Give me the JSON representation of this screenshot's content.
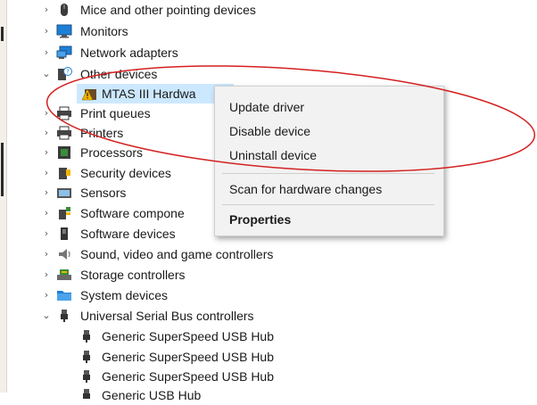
{
  "tree": {
    "items": [
      {
        "label": "Mice and other pointing devices",
        "expanded": false,
        "icon": "mouse-icon"
      },
      {
        "label": "Monitors",
        "expanded": false,
        "icon": "monitor-icon"
      },
      {
        "label": "Network adapters",
        "expanded": false,
        "icon": "network-adapter-icon"
      },
      {
        "label": "Other devices",
        "expanded": true,
        "icon": "other-devices-icon"
      },
      {
        "label": "MTAS III Hardwa",
        "child": true,
        "selected": true,
        "icon": "warning-device-icon"
      },
      {
        "label": "Print queues",
        "expanded": false,
        "icon": "print-queue-icon"
      },
      {
        "label": "Printers",
        "expanded": false,
        "icon": "printer-icon"
      },
      {
        "label": "Processors",
        "expanded": false,
        "icon": "processor-icon"
      },
      {
        "label": "Security devices",
        "expanded": false,
        "icon": "security-device-icon"
      },
      {
        "label": "Sensors",
        "expanded": false,
        "icon": "sensor-icon"
      },
      {
        "label": "Software compone",
        "expanded": false,
        "icon": "software-component-icon"
      },
      {
        "label": "Software devices",
        "expanded": false,
        "icon": "software-device-icon"
      },
      {
        "label": "Sound, video and game controllers",
        "expanded": false,
        "icon": "speaker-icon"
      },
      {
        "label": "Storage controllers",
        "expanded": false,
        "icon": "storage-controller-icon"
      },
      {
        "label": "System devices",
        "expanded": false,
        "icon": "system-folder-icon"
      },
      {
        "label": "Universal Serial Bus controllers",
        "expanded": true,
        "icon": "usb-icon"
      },
      {
        "label": "Generic SuperSpeed USB Hub",
        "child": true,
        "icon": "usb-plug-icon"
      },
      {
        "label": "Generic SuperSpeed USB Hub",
        "child": true,
        "icon": "usb-plug-icon"
      },
      {
        "label": "Generic SuperSpeed USB Hub",
        "child": true,
        "icon": "usb-plug-icon"
      },
      {
        "label": "Generic USB Hub",
        "child": true,
        "icon": "usb-plug-icon"
      }
    ]
  },
  "context_menu": {
    "update_driver": "Update driver",
    "disable_device": "Disable device",
    "uninstall_device": "Uninstall device",
    "scan": "Scan for hardware changes",
    "properties": "Properties"
  },
  "colors": {
    "selection": "#cce8ff",
    "menu_background": "#f2f2f2",
    "annotation_oval": "#d42020",
    "warning": "#f2b300"
  }
}
